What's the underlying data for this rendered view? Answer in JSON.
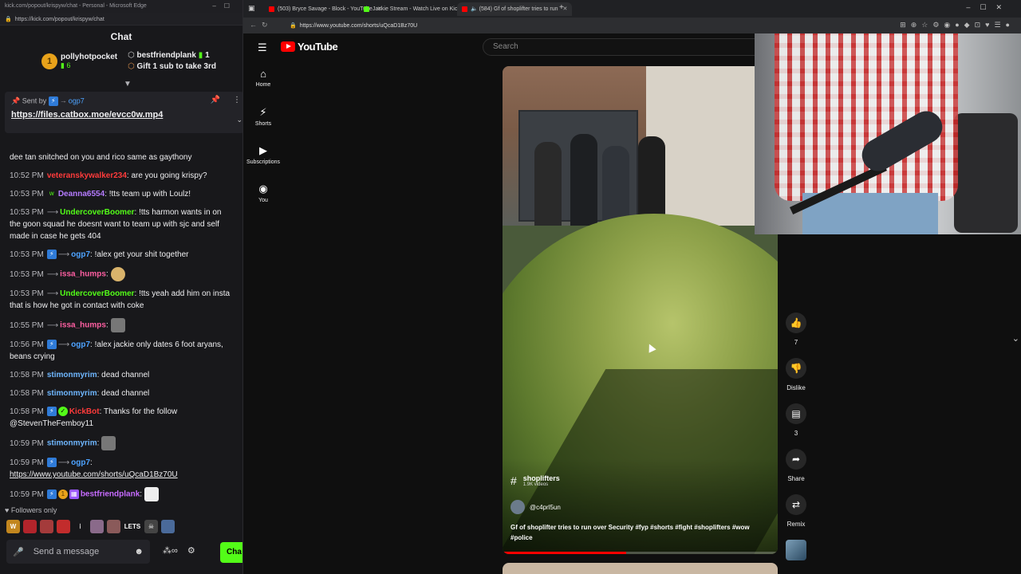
{
  "chat_window": {
    "title_bar": "kick.com/popout/krispyw/chat - Personal - Microsoft Edge",
    "url": "https://kick.com/popout/krispyw/chat",
    "header": "Chat",
    "leaderboard": {
      "rank1_badge": "1",
      "rank1_name": "pollyhotpocket",
      "rank1_count": "6",
      "rank2_name": "bestfriendplank",
      "rank2_count": "1",
      "gift_text": "Gift 1 sub to take 3rd"
    },
    "pinned": {
      "sent_by_label": "Sent by",
      "sent_by_user": "ogp7",
      "link": "https://files.catbox.moe/evcc0w.mp4"
    },
    "messages": [
      {
        "time": "",
        "user": "",
        "user_color": "#efeff1",
        "text": "dee tan snitched on you and rico same as gaythony"
      },
      {
        "time": "10:52 PM",
        "user": "veteranskywalker234",
        "user_color": "#ff3b3b",
        "text": "are you going krispy?"
      },
      {
        "time": "10:53 PM",
        "user": "Deanna6554",
        "user_color": "#b57bff",
        "text": "!tts team up with Loulz!"
      },
      {
        "time": "10:53 PM",
        "user": "UndercoverBoomer",
        "user_color": "#53fc18",
        "text": "!tts harmon wants in on the goon squad he doesnt want to team up with sjc and self made in case he gets 404"
      },
      {
        "time": "10:53 PM",
        "user": "ogp7",
        "user_color": "#4da3ff",
        "text": "!alex get your shit together"
      },
      {
        "time": "10:53 PM",
        "user": "issa_humps",
        "user_color": "#ff5fa2",
        "text": ""
      },
      {
        "time": "10:53 PM",
        "user": "UndercoverBoomer",
        "user_color": "#53fc18",
        "text": "!tts yeah add him on insta that is how he got in contact with coke"
      },
      {
        "time": "10:55 PM",
        "user": "issa_humps",
        "user_color": "#ff5fa2",
        "text": ""
      },
      {
        "time": "10:56 PM",
        "user": "ogp7",
        "user_color": "#4da3ff",
        "text": "!alex jackie only dates 6 foot aryans, beans crying"
      },
      {
        "time": "10:58 PM",
        "user": "stimonmyrim",
        "user_color": "#6fb7ff",
        "text": "dead channel"
      },
      {
        "time": "10:58 PM",
        "user": "stimonmyrim",
        "user_color": "#6fb7ff",
        "text": "dead channel"
      },
      {
        "time": "10:58 PM",
        "user": "KickBot",
        "user_color": "#ff3b3b",
        "text": "Thanks for the follow @StevenTheFemboy11"
      },
      {
        "time": "10:59 PM",
        "user": "stimonmyrim",
        "user_color": "#6fb7ff",
        "text": ""
      },
      {
        "time": "10:59 PM",
        "user": "ogp7",
        "user_color": "#4da3ff",
        "text": "https://www.youtube.com/shorts/uQcaD1Bz70U"
      },
      {
        "time": "10:59 PM",
        "user": "bestfriendplank",
        "user_color": "#c66bff",
        "text": ""
      }
    ],
    "followers_only": "Followers only",
    "emote_lets": "LETS",
    "input_placeholder": "Send a message",
    "send_label": "Cha"
  },
  "browser": {
    "tabs": [
      {
        "label": "(503) Bryce Savage - Block - YouTube",
        "fav_color": "#ff0000"
      },
      {
        "label": "Jackie Stream - Watch Live on Kick",
        "fav_color": "#53fc18"
      },
      {
        "label": "(584) Gf of shoplifter tries to run",
        "fav_color": "#ff0000"
      }
    ],
    "url": "https://www.youtube.com/shorts/uQcaD1Bz70U"
  },
  "youtube": {
    "logo_text": "YouTube",
    "search_placeholder": "Search",
    "rail": [
      {
        "label": "Home",
        "icon": "home-icon"
      },
      {
        "label": "Shorts",
        "icon": "shorts-icon"
      },
      {
        "label": "Subscriptions",
        "icon": "subscriptions-icon"
      },
      {
        "label": "You",
        "icon": "you-icon"
      }
    ],
    "short": {
      "hashtag_name": "shoplifters",
      "hashtag_sub": "1.9K videos",
      "channel": "@c4prl5un",
      "caption": "Gf of shoplifter tries to run over Security #fyp #shorts #fight #shoplifters #wow #police",
      "progress": 0.45
    },
    "actions": {
      "likes": "7",
      "dislike_label": "Dislike",
      "comments": "3",
      "share_label": "Share",
      "remix_label": "Remix"
    }
  }
}
